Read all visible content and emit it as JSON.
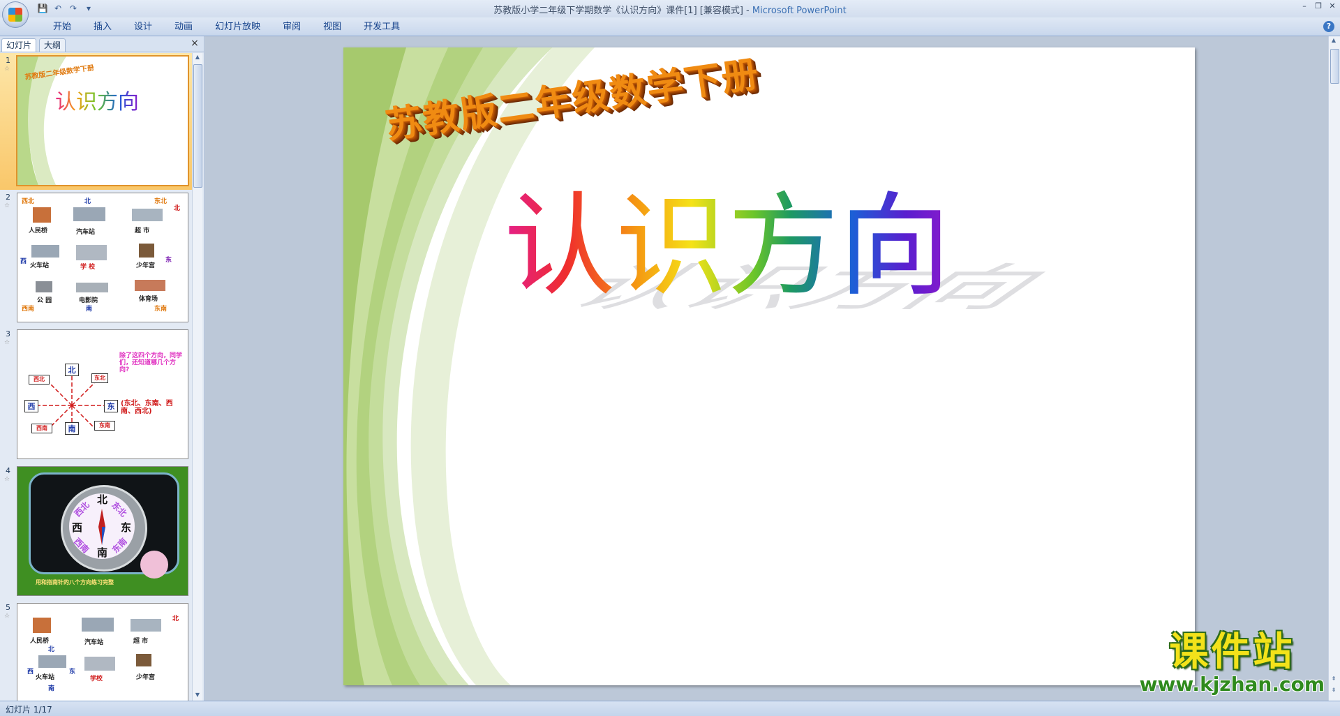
{
  "window": {
    "title": "苏教版小学二年级下学期数学《认识方向》课件[1] [兼容模式] - ",
    "app_name": "Microsoft PowerPoint"
  },
  "ribbon": {
    "tabs": [
      "开始",
      "插入",
      "设计",
      "动画",
      "幻灯片放映",
      "审阅",
      "视图",
      "开发工具"
    ]
  },
  "pane": {
    "tabs": [
      "幻灯片",
      "大纲"
    ],
    "slides": [
      {
        "num": "1",
        "sub": "苏教版二年级数学下册",
        "title": "认识方向"
      },
      {
        "num": "2",
        "labels": [
          "西北",
          "北",
          "东北",
          "北",
          "人民桥",
          "汽车站",
          "超 市",
          "西",
          "火车站",
          "学 校",
          "少年宫",
          "东",
          "公 园",
          "电影院",
          "体育场",
          "西南",
          "南",
          "东南"
        ]
      },
      {
        "num": "3",
        "note": "除了这四个方向，同学们，还知道哪几个方向?",
        "dirs": [
          "北",
          "东北",
          "西北",
          "西",
          "东",
          "南",
          "西南",
          "东南"
        ],
        "answer": "(东北、东南、西南、西北)"
      },
      {
        "num": "4",
        "compass": [
          "北",
          "东北",
          "西北",
          "西",
          "东",
          "西南",
          "东南",
          "南"
        ],
        "caption": "用和指南针的八个方向练习完整"
      },
      {
        "num": "5",
        "labels": [
          "北",
          "人民桥",
          "汽车站",
          "超 市",
          "北",
          "西",
          "东",
          "火车站",
          "学校",
          "少年宫",
          "南"
        ]
      }
    ]
  },
  "slide": {
    "subtitle": "苏教版二年级数学下册",
    "title": "认识方向"
  },
  "status": {
    "text": "幻灯片 1/17"
  },
  "watermark": {
    "title": "课件站",
    "url": "www.kjzhan.com"
  },
  "colors": {
    "accent": "#15428b",
    "selected": "#f9c76a"
  }
}
